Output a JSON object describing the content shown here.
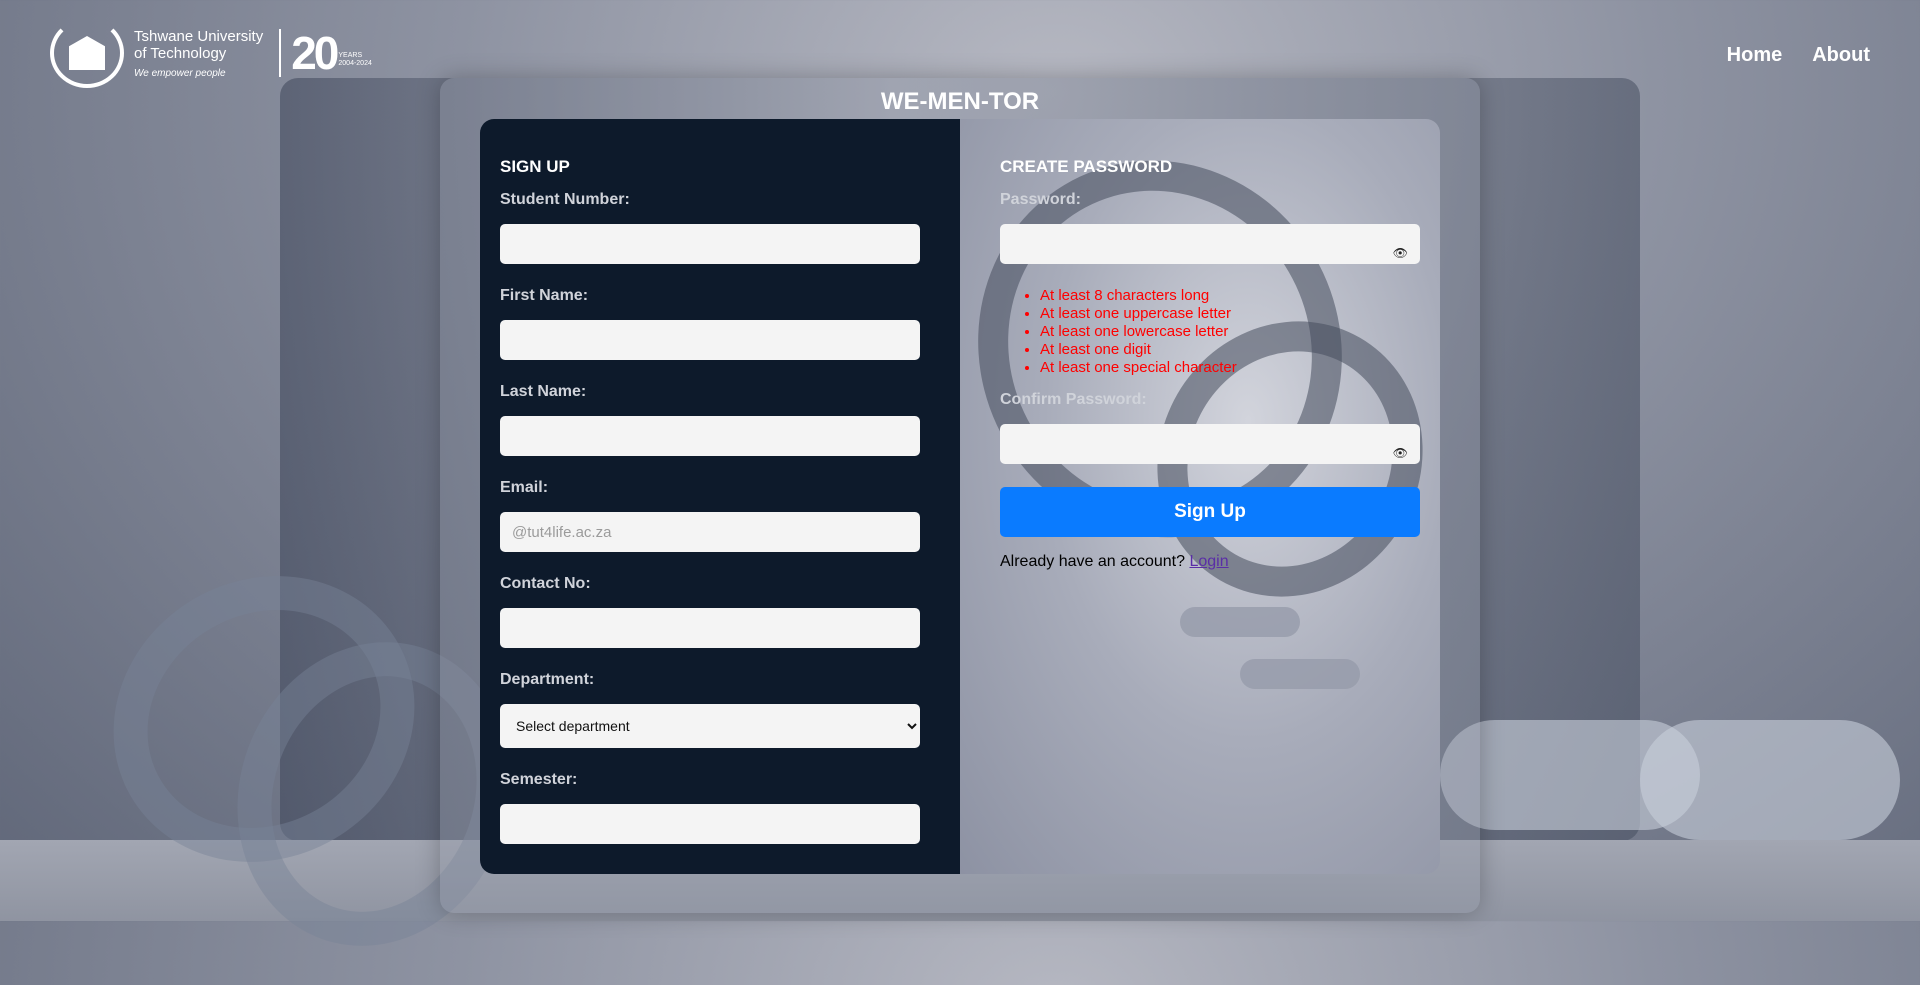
{
  "header": {
    "logo_line1": "Tshwane University",
    "logo_line2": "of Technology",
    "logo_tagline": "We empower people",
    "anniversary_number": "20",
    "anniversary_years": "YEARS",
    "anniversary_range": "2004-2024",
    "nav": {
      "home": "Home",
      "about": "About"
    }
  },
  "card": {
    "title": "WE-MEN-TOR"
  },
  "signup": {
    "title": "SIGN UP",
    "student_number_label": "Student Number:",
    "first_name_label": "First Name:",
    "last_name_label": "Last Name:",
    "email_label": "Email:",
    "email_placeholder": "@tut4life.ac.za",
    "contact_label": "Contact No:",
    "department_label": "Department:",
    "department_selected": "Select department",
    "semester_label": "Semester:"
  },
  "password": {
    "title": "CREATE PASSWORD",
    "password_label": "Password:",
    "rules": [
      "At least 8 characters long",
      "At least one uppercase letter",
      "At least one lowercase letter",
      "At least one digit",
      "At least one special character"
    ],
    "confirm_label": "Confirm Password:",
    "eye_icon": "eye-icon",
    "signup_button": "Sign Up",
    "account_prompt": "Already have an account?",
    "login_link": "Login"
  },
  "colors": {
    "left_panel": "#0d1a2b",
    "button": "#0a7bff",
    "rule_text": "#ff0000",
    "link": "#5a2ea6"
  }
}
